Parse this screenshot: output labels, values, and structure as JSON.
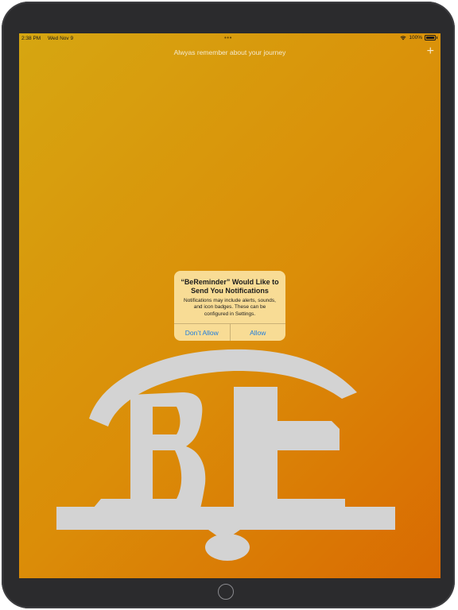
{
  "status_bar": {
    "time": "2:38 PM",
    "date": "Wed Nov 9",
    "battery": "100%"
  },
  "nav": {
    "title": "Alwyas remember about your journey",
    "add_label": "+"
  },
  "alert": {
    "title": "“BeReminder” Would Like to Send You Notifications",
    "message": "Notifications may include alerts, sounds, and icon badges. These can be configured in Settings.",
    "deny_label": "Don’t Allow",
    "allow_label": "Allow",
    "button_color": "#1f7ddd"
  },
  "logo": {
    "color": "#d3d3d3"
  },
  "icons": {
    "wifi": "wifi-icon",
    "battery": "battery-icon",
    "add": "plus-icon",
    "multitask": "multitasking-dots-icon"
  },
  "colors": {
    "gradient_start": "#d6a611",
    "gradient_end": "#d96a02",
    "device_frame": "#2b2b2d"
  }
}
